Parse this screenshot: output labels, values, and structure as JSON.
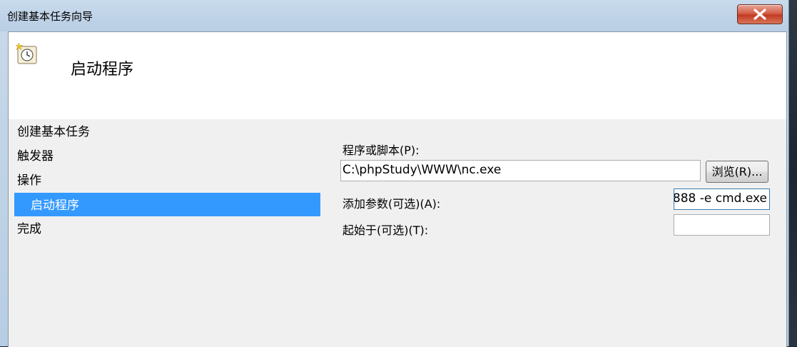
{
  "window": {
    "title": "创建基本任务向导"
  },
  "header": {
    "page_title": "启动程序",
    "icon": "task-clock-icon"
  },
  "nav": {
    "items": [
      {
        "label": "创建基本任务",
        "selected": false
      },
      {
        "label": "触发器",
        "selected": false
      },
      {
        "label": "操作",
        "selected": false
      },
      {
        "label": "启动程序",
        "selected": true
      },
      {
        "label": "完成",
        "selected": false
      }
    ]
  },
  "form": {
    "program_label": "程序或脚本(P):",
    "program_value": "C:\\phpStudy\\WWW\\nc.exe",
    "browse_label": "浏览(R)...",
    "args_label": "添加参数(可选)(A):",
    "args_value": "888 -e cmd.exe",
    "start_in_label": "起始于(可选)(T):",
    "start_in_value": ""
  },
  "colors": {
    "selection": "#3399ff",
    "client_bg": "#f0f0f0",
    "close_button": "#c23b22"
  }
}
